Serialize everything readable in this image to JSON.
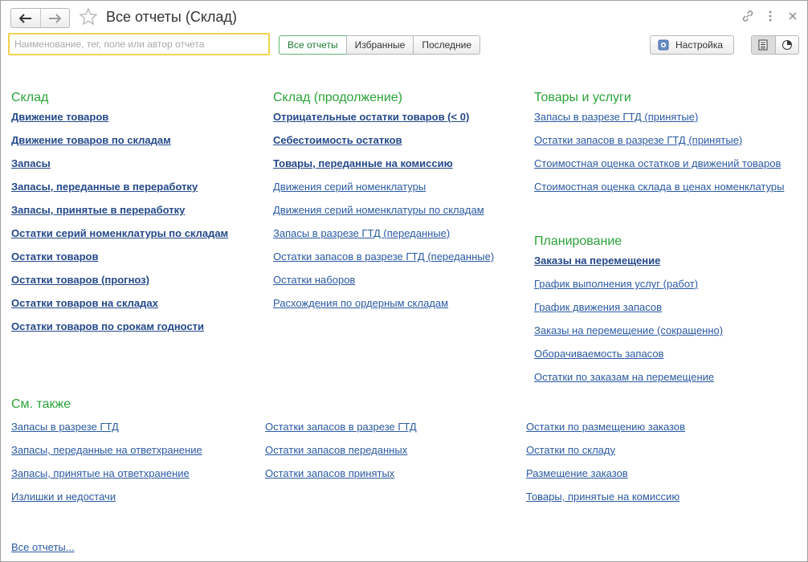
{
  "header": {
    "title": "Все отчеты (Склад)",
    "back_icon": "arrow-left-icon",
    "forward_icon": "arrow-right-icon",
    "favorite_icon": "star-icon",
    "link_icon": "link-icon",
    "menu_icon": "more-vertical-icon",
    "close_icon": "close-icon"
  },
  "toolbar": {
    "search_placeholder": "Наименование, тег, поле или автор отчета",
    "search_value": "",
    "tabs": [
      "Все отчеты",
      "Избранные",
      "Последние"
    ],
    "active_tab": "Все отчеты",
    "settings_label": "Настройка"
  },
  "sections": {
    "sklad": {
      "title": "Склад",
      "items": [
        "Движение товаров",
        "Движение товаров по складам",
        "Запасы",
        "Запасы, переданные в переработку",
        "Запасы, принятые в переработку",
        "Остатки серий номенклатуры по складам",
        "Остатки товаров",
        "Остатки товаров (прогноз)",
        "Остатки товаров на складах",
        "Остатки товаров по срокам годности"
      ]
    },
    "sklad_cont": {
      "title": "Склад (продолжение)",
      "items": [
        "Отрицательные остатки товаров (< 0)",
        "Себестоимость остатков",
        "Товары, переданные на комиссию",
        "Движения серий номенклатуры",
        "Движения серий номенклатуры по складам",
        "Запасы в разрезе ГТД (переданные)",
        "Остатки запасов в разрезе ГТД (переданные)",
        "Остатки наборов",
        "Расхождения по ордерным складам"
      ]
    },
    "goods": {
      "title": "Товары и услуги",
      "items": [
        "Запасы в разрезе ГТД (принятые)",
        "Остатки запасов в разрезе ГТД (принятые)",
        "Стоимостная оценка остатков и движений товаров",
        "Стоимостная оценка склада в ценах номенклатуры"
      ]
    },
    "planning": {
      "title": "Планирование",
      "items": [
        "Заказы на перемещение",
        "График выполнения услуг (работ)",
        "График движения запасов",
        "Заказы на перемещение (сокращенно)",
        "Оборачиваемость запасов",
        "Остатки по заказам на перемещение"
      ]
    },
    "see_also": {
      "title": "См. также",
      "col1": [
        "Запасы в разрезе ГТД",
        "Запасы, переданные на ответхранение",
        "Запасы, принятые на ответхранение",
        "Излишки и недостачи"
      ],
      "col2": [
        "Остатки запасов в разрезе ГТД",
        "Остатки запасов переданных",
        "Остатки запасов принятых"
      ],
      "col3": [
        "Остатки по размещению заказов",
        "Остатки по складу",
        "Размещение заказов",
        "Товары, принятые на комиссию"
      ]
    }
  },
  "footer": {
    "all_reports_link": "Все отчеты..."
  },
  "colors": {
    "section_title": "#2aa339",
    "link": "#2a5aa3",
    "search_border": "#f2d24d"
  }
}
